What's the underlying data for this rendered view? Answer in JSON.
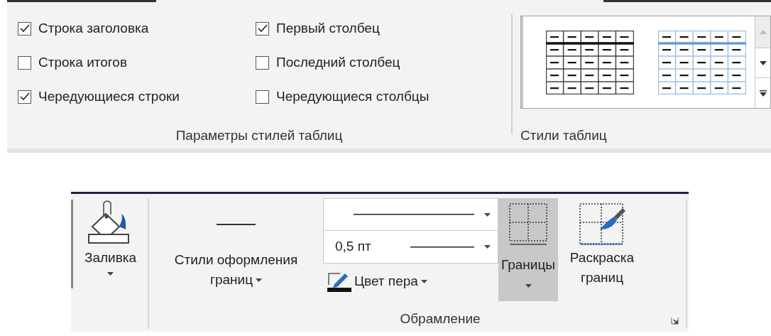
{
  "table_style_options": {
    "checkboxes": [
      {
        "label": "Строка заголовка",
        "checked": true
      },
      {
        "label": "Строка итогов",
        "checked": false
      },
      {
        "label": "Чередующиеся строки",
        "checked": true
      },
      {
        "label": "Первый столбец",
        "checked": true
      },
      {
        "label": "Последний столбец",
        "checked": false
      },
      {
        "label": "Чередующиеся столбцы",
        "checked": false
      }
    ],
    "group_label": "Параметры стилей таблиц"
  },
  "table_styles": {
    "styles": [
      {
        "kind": "grid"
      },
      {
        "kind": "light-grid"
      }
    ],
    "group_label": "Стили таблиц"
  },
  "borders": {
    "fill_button": {
      "label": "Заливка"
    },
    "border_styles_button": {
      "label": "Стили оформления границ"
    },
    "line_weight": {
      "value": "0,5 пт"
    },
    "pen_color_button": {
      "label": "Цвет пера"
    },
    "borders_button": {
      "label": "Границы",
      "selected": true
    },
    "border_painter_button": {
      "label": "Раскраска границ"
    },
    "group_label": "Обрамление"
  }
}
